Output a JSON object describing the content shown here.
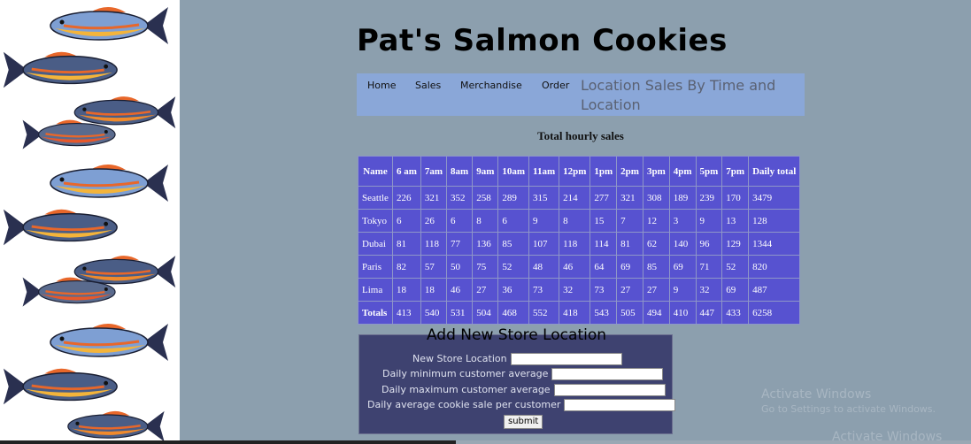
{
  "page": {
    "title": "Pat's Salmon Cookies"
  },
  "nav": {
    "items": [
      {
        "label": "Home"
      },
      {
        "label": "Sales"
      },
      {
        "label": "Merchandise"
      },
      {
        "label": "Order"
      }
    ],
    "heading": "Location Sales By Time and Location"
  },
  "table": {
    "caption": "Total hourly sales",
    "headers": [
      "Name",
      "6 am",
      "7am",
      "8am",
      "9am",
      "10am",
      "11am",
      "12pm",
      "1pm",
      "2pm",
      "3pm",
      "4pm",
      "5pm",
      "7pm",
      "Daily total"
    ],
    "rows": [
      [
        "Seattle",
        "226",
        "321",
        "352",
        "258",
        "289",
        "315",
        "214",
        "277",
        "321",
        "308",
        "189",
        "239",
        "170",
        "3479"
      ],
      [
        "Tokyo",
        "6",
        "26",
        "6",
        "8",
        "6",
        "9",
        "8",
        "15",
        "7",
        "12",
        "3",
        "9",
        "13",
        "128"
      ],
      [
        "Dubai",
        "81",
        "118",
        "77",
        "136",
        "85",
        "107",
        "118",
        "114",
        "81",
        "62",
        "140",
        "96",
        "129",
        "1344"
      ],
      [
        "Paris",
        "82",
        "57",
        "50",
        "75",
        "52",
        "48",
        "46",
        "64",
        "69",
        "85",
        "69",
        "71",
        "52",
        "820"
      ],
      [
        "Lima",
        "18",
        "18",
        "46",
        "27",
        "36",
        "73",
        "32",
        "73",
        "27",
        "27",
        "9",
        "32",
        "69",
        "487"
      ],
      [
        "Totals",
        "413",
        "540",
        "531",
        "504",
        "468",
        "552",
        "418",
        "543",
        "505",
        "494",
        "410",
        "447",
        "433",
        "6258"
      ]
    ],
    "colors": {
      "background": "#5752d0",
      "border": "#8e96c8"
    }
  },
  "form": {
    "legend": "Add New Store Location",
    "fields": [
      {
        "label": "New Store Location",
        "value": ""
      },
      {
        "label": "Daily minimum customer average",
        "value": ""
      },
      {
        "label": "Daily maximum customer average",
        "value": ""
      },
      {
        "label": "Daily average cookie sale per customer",
        "value": ""
      }
    ],
    "submit_label": "submit"
  },
  "watermark": {
    "line1": "Activate Windows",
    "line2": "Go to Settings to activate Windows.",
    "overflow": "Activate Windows"
  },
  "decor": {
    "strip_icon": "salmon-fish-icon",
    "colors": {
      "page_bg": "#8c9fae",
      "nav_bg": "#8aa7d8",
      "form_bg": "#3e4270"
    }
  }
}
